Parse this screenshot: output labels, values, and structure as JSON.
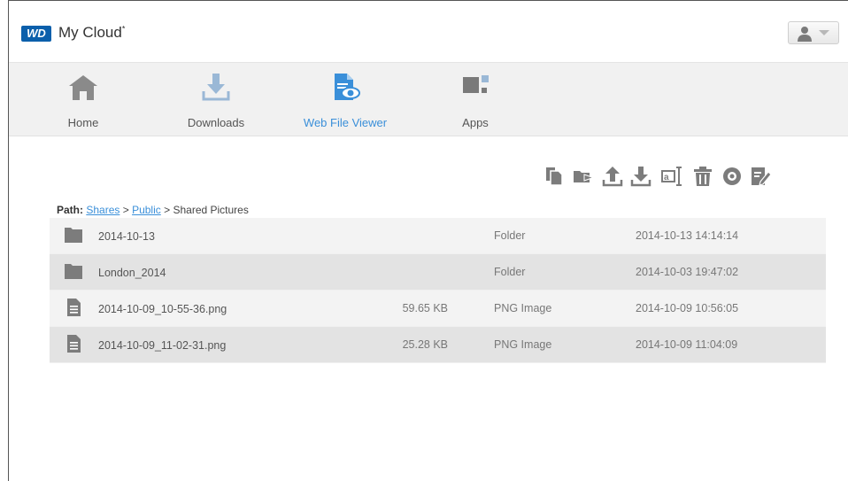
{
  "header": {
    "logo_text": "WD",
    "app_title": "My Cloud",
    "app_title_mark": "*"
  },
  "nav": [
    {
      "label": "Home",
      "icon": "home-icon",
      "active": false
    },
    {
      "label": "Downloads",
      "icon": "download-icon",
      "active": false
    },
    {
      "label": "Web File Viewer",
      "icon": "file-viewer-icon",
      "active": true
    },
    {
      "label": "Apps",
      "icon": "apps-icon",
      "active": false
    }
  ],
  "toolbar": [
    "copy-icon",
    "move-icon",
    "upload-icon",
    "download-icon",
    "rename-icon",
    "delete-icon",
    "view-icon",
    "edit-icon"
  ],
  "path": {
    "label": "Path:",
    "crumbs": [
      "Shares",
      "Public"
    ],
    "separator": ">",
    "current": "Shared Pictures"
  },
  "files": [
    {
      "name": "2014-10-13",
      "size": "",
      "type": "Folder",
      "date": "2014-10-13 14:14:14",
      "kind": "folder"
    },
    {
      "name": "London_2014",
      "size": "",
      "type": "Folder",
      "date": "2014-10-03 19:47:02",
      "kind": "folder"
    },
    {
      "name": "2014-10-09_10-55-36.png",
      "size": "59.65 KB",
      "type": "PNG Image",
      "date": "2014-10-09 10:56:05",
      "kind": "file"
    },
    {
      "name": "2014-10-09_11-02-31.png",
      "size": "25.28 KB",
      "type": "PNG Image",
      "date": "2014-10-09 11:04:09",
      "kind": "file"
    }
  ],
  "colors": {
    "accent": "#3a8fd9",
    "icon_gray": "#7c7c7c",
    "brand": "#0b5fab"
  }
}
